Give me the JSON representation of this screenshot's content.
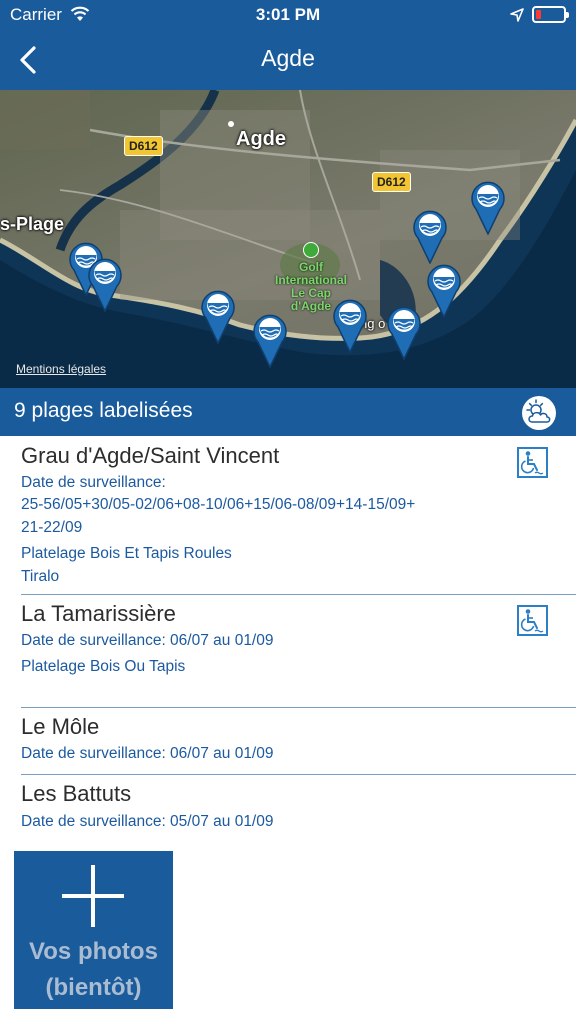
{
  "status_bar": {
    "carrier": "Carrier",
    "time": "3:01 PM",
    "battery_color": "#ff3b30"
  },
  "nav": {
    "title": "Agde",
    "back_icon": "chevron-left-icon"
  },
  "map": {
    "city_label": "Agde",
    "west_label": "s-Plage",
    "road_labels": [
      "D612",
      "D612"
    ],
    "golf_label": [
      "Golf",
      "International",
      "Le Cap",
      "d'Agde"
    ],
    "coast_label": "ng   o",
    "legal_link": "Mentions légales",
    "pin_icon": "blue-flag-beach-pin-icon",
    "pin_count": 9
  },
  "section": {
    "title": "9 plages labelisées",
    "weather_icon": "sun-cloud-icon"
  },
  "beaches": [
    {
      "name": "Grau d'Agde/Saint Vincent",
      "lines": [
        "Date de surveillance:",
        "25-56/05+30/05-02/06+08-10/06+15/06-08/09+14-15/09+",
        "21-22/09",
        "Platelage Bois Et Tapis Roules",
        "Tiralo"
      ],
      "accessible": true
    },
    {
      "name": "La Tamarissière",
      "lines": [
        "Date de surveillance: 06/07 au 01/09",
        "Platelage Bois Ou Tapis"
      ],
      "accessible": true
    },
    {
      "name": "Le Môle",
      "lines": [
        "Date de surveillance: 06/07 au 01/09"
      ],
      "accessible": false
    },
    {
      "name": "Les Battuts",
      "lines": [
        "Date de surveillance: 05/07 au 01/09"
      ],
      "accessible": false
    }
  ],
  "photos": {
    "label_line1": "Vos photos",
    "label_line2": "(bientôt)",
    "icon": "plus-icon"
  },
  "colors": {
    "brand_blue": "#1a5b9c",
    "link_blue": "#1c5aa0",
    "access_blue": "#2a7fc5"
  }
}
